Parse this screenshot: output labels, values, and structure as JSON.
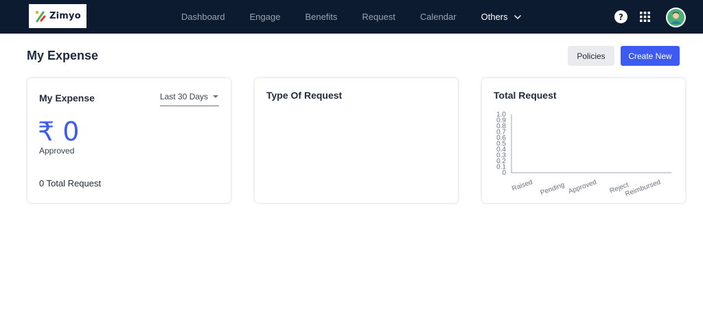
{
  "app": {
    "logo_text": "Zimyo"
  },
  "nav": {
    "items": [
      "Dashboard",
      "Engage",
      "Benefits",
      "Request",
      "Calendar"
    ],
    "others_label": "Others"
  },
  "header": {
    "help_label": "?",
    "page_title": "My Expense",
    "policies_label": "Policies",
    "create_label": "Create New"
  },
  "summary_card": {
    "title": "My Expense",
    "range_value": "Last 30 Days",
    "currency_symbol": "₹",
    "amount": "0",
    "amount_label": "Approved",
    "total_request_text": "0 Total Request"
  },
  "type_card": {
    "title": "Type Of Request"
  },
  "total_card": {
    "title": "Total Request"
  },
  "chart_data": {
    "type": "bar",
    "categories": [
      "Raised",
      "Pending",
      "Approved",
      "Reject",
      "Reimbursed"
    ],
    "values": [
      0,
      0,
      0,
      0,
      0
    ],
    "yticks": [
      "0",
      "0.1",
      "0.2",
      "0.3",
      "0.4",
      "0.5",
      "0.6",
      "0.7",
      "0.8",
      "0.9",
      "1.0"
    ],
    "ylim": [
      0,
      1.0
    ],
    "grid": false
  },
  "colors": {
    "topbar": "#0c1b30",
    "accent": "#3d5af1",
    "nav_inactive": "#9aa3af"
  },
  "icons": {
    "help": "help-icon",
    "apps": "grid-icon",
    "avatar": "avatar",
    "dropdown": "chevron-down-icon"
  }
}
